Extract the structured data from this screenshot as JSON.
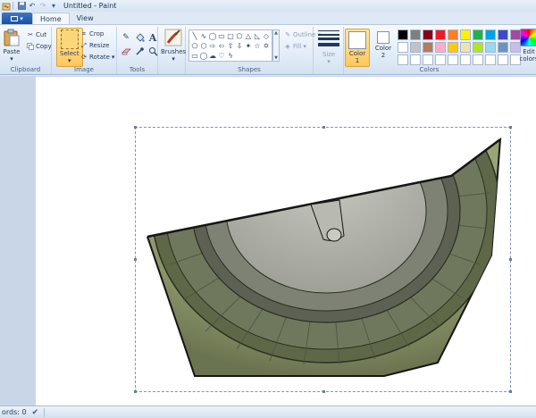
{
  "titlebar": {
    "title": "Untitled - Paint",
    "quick_access": [
      "paint-app-icon",
      "save-icon",
      "undo-icon",
      "redo-icon",
      "customize-icon"
    ]
  },
  "tabs": {
    "menu_icon": "app-menu-icon",
    "items": [
      {
        "label": "Home",
        "active": true
      },
      {
        "label": "View",
        "active": false
      }
    ]
  },
  "ribbon": {
    "clipboard": {
      "label": "Clipboard",
      "paste": "Paste",
      "cut": "Cut",
      "copy": "Copy"
    },
    "image": {
      "label": "Image",
      "select": "Select",
      "crop": "Crop",
      "resize": "Resize",
      "rotate": "Rotate"
    },
    "tools": {
      "label": "Tools",
      "items": [
        "pencil-icon",
        "fill-icon",
        "text-icon",
        "eraser-icon",
        "color-picker-icon",
        "magnifier-icon"
      ],
      "text_glyph": "A"
    },
    "brushes": {
      "label": "Brushes"
    },
    "shapes": {
      "label": "Shapes",
      "outline": "Outline",
      "fill": "Fill"
    },
    "size": {
      "label": "Size"
    },
    "colors": {
      "label": "Colors",
      "color1": {
        "label": "Color",
        "number": "1",
        "value": "#ffffff"
      },
      "color2": {
        "label": "Color",
        "number": "2",
        "value": "#ffffff"
      },
      "edit_label": "Edit",
      "edit_label2": "colors",
      "palette": [
        "#000000",
        "#7f7f7f",
        "#880015",
        "#ed1c24",
        "#ff7f27",
        "#fff200",
        "#22b14c",
        "#00a2e8",
        "#3f48cc",
        "#a349a4",
        "#ffffff",
        "#c3c3c3",
        "#b97a57",
        "#ffaec9",
        "#ffc90e",
        "#efe4b0",
        "#b5e61d",
        "#99d9ea",
        "#7092be",
        "#c8bfe7",
        "#ffffff",
        "#ffffff",
        "#ffffff",
        "#ffffff",
        "#ffffff",
        "#ffffff",
        "#ffffff",
        "#ffffff",
        "#ffffff",
        "#ffffff"
      ]
    }
  },
  "drawing": {
    "colors": {
      "olive_light": "#a3ad7a",
      "olive_dark": "#5e6848",
      "band_dark": "#5c6153",
      "inner_gray": "#b3b4ac",
      "outline": "#151515"
    }
  },
  "statusbar": {
    "text": "ords: 0"
  }
}
